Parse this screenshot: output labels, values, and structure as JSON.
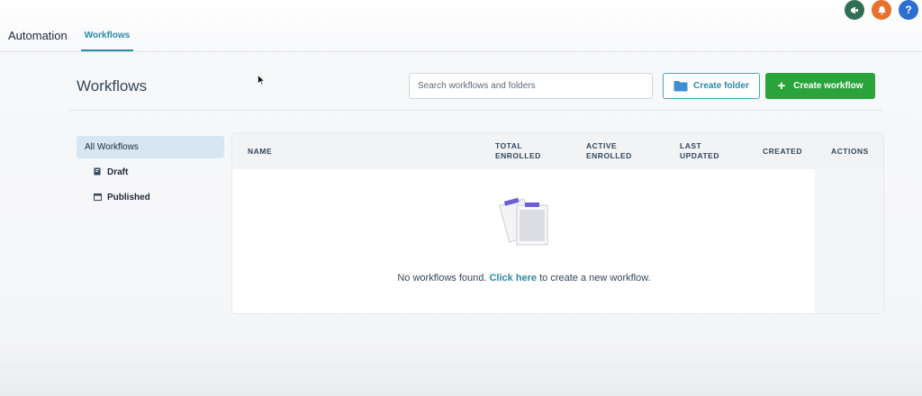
{
  "top_icons": [
    {
      "name": "megaphone-icon",
      "glyph": "◀",
      "color": "#2f6f55"
    },
    {
      "name": "bell-icon",
      "glyph": "▲",
      "color": "#e8702a"
    },
    {
      "name": "help-icon",
      "glyph": "?",
      "color": "#2d6fd1"
    }
  ],
  "header": {
    "app_title": "Automation",
    "tabs": [
      {
        "label": "Workflows"
      }
    ]
  },
  "page": {
    "title": "Workflows",
    "search_placeholder": "Search workflows and folders",
    "create_folder_label": "Create folder",
    "create_workflow_label": "Create workflow"
  },
  "sidebar": {
    "items": [
      {
        "label": "All Workflows",
        "icon": ""
      },
      {
        "label": "Draft",
        "icon": "draft-icon"
      },
      {
        "label": "Published",
        "icon": "published-icon"
      }
    ]
  },
  "table": {
    "columns": [
      {
        "line1": "NAME",
        "line2": ""
      },
      {
        "line1": "TOTAL",
        "line2": "ENROLLED"
      },
      {
        "line1": "ACTIVE",
        "line2": "ENROLLED"
      },
      {
        "line1": "LAST",
        "line2": "UPDATED"
      },
      {
        "line1": "CREATED",
        "line2": ""
      },
      {
        "line1": "ACTIONS",
        "line2": ""
      }
    ],
    "empty": {
      "prefix": "No workflows found.",
      "link": "Click here",
      "suffix": "to create a new workflow."
    }
  },
  "colors": {
    "accent": "#2b8aa8",
    "primary_button": "#2aa33b",
    "active_sidebar": "#d6e7f3"
  }
}
